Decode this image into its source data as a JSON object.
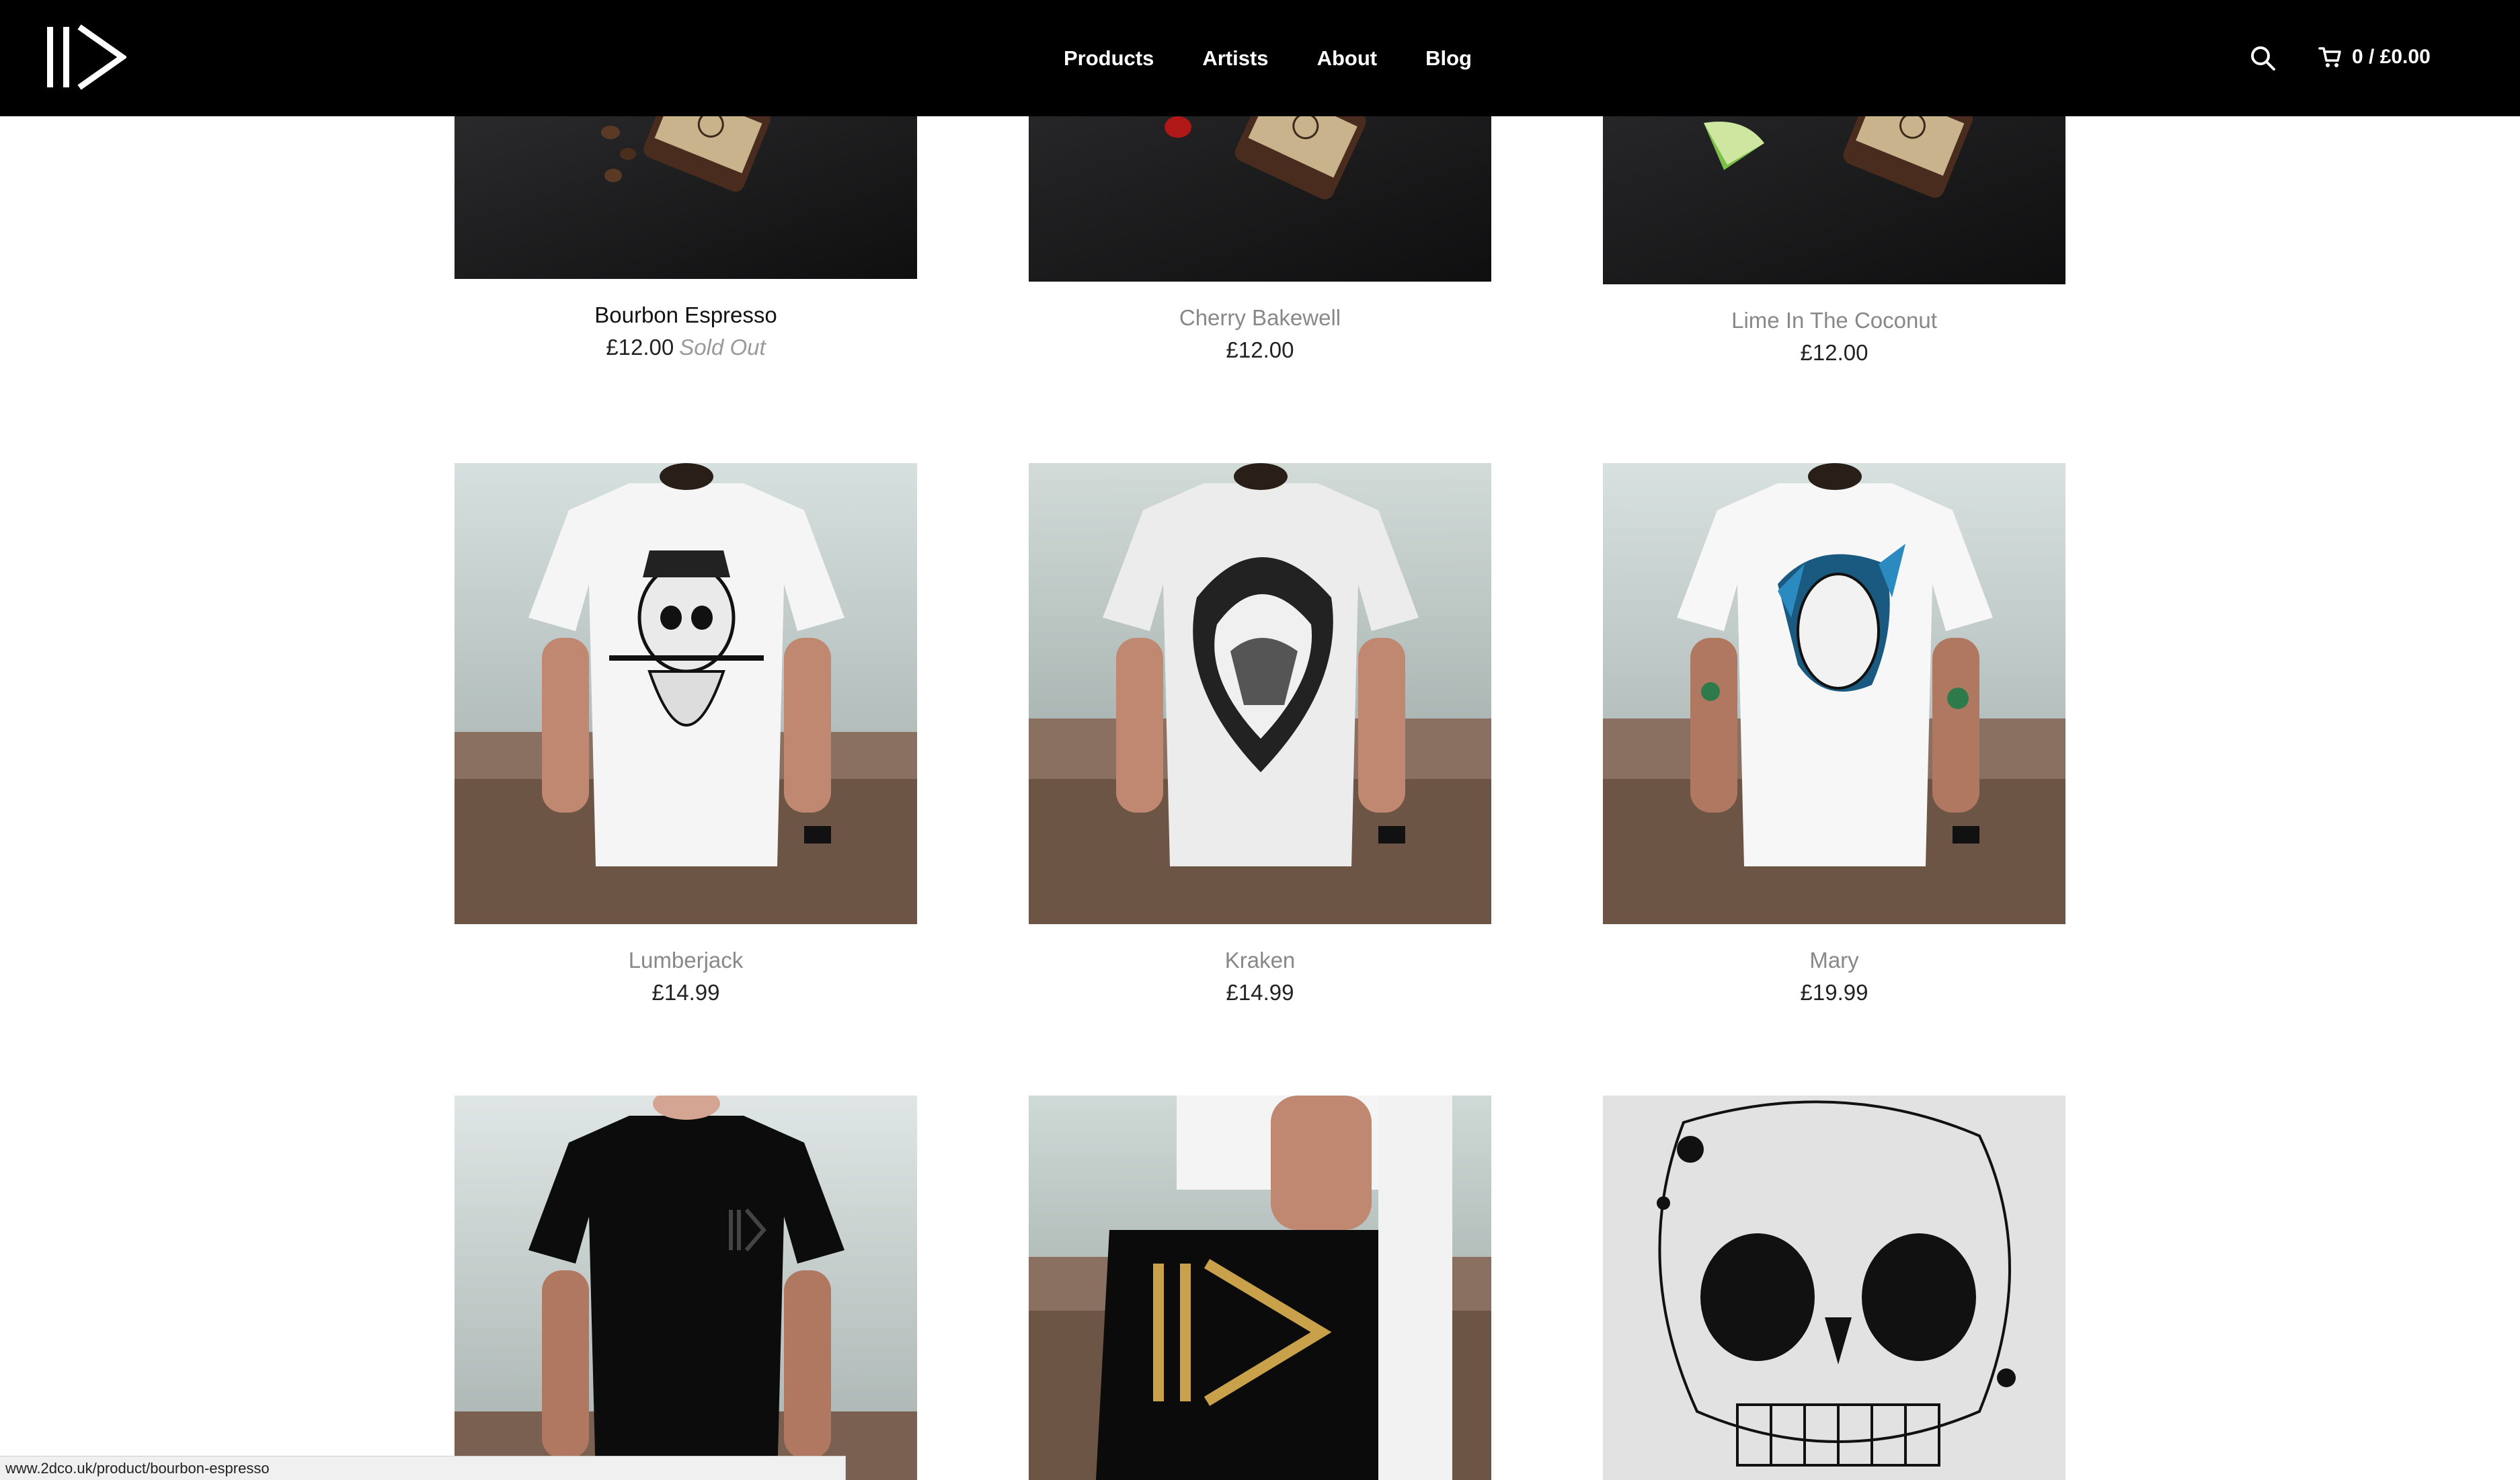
{
  "header": {
    "logo_name": "2dco-logo",
    "nav": [
      "Products",
      "Artists",
      "About",
      "Blog"
    ],
    "cart_label": "0 / £0.00"
  },
  "products": [
    {
      "title": "Bourbon Espresso",
      "price": "£12.00",
      "sold_out": "Sold Out"
    },
    {
      "title": "Cherry Bakewell",
      "price": "£12.00"
    },
    {
      "title": "Lime In The Coconut",
      "price": "£12.00"
    },
    {
      "title": "Lumberjack",
      "price": "£14.99"
    },
    {
      "title": "Kraken",
      "price": "£14.99"
    },
    {
      "title": "Mary",
      "price": "£19.99"
    }
  ],
  "status_bar": {
    "url": "www.2dco.uk/product/bourbon-espresso"
  },
  "colors": {
    "header_bg": "#000000",
    "title_muted": "#888888",
    "title_active": "#111111",
    "sold_out": "#9a9a9a"
  }
}
